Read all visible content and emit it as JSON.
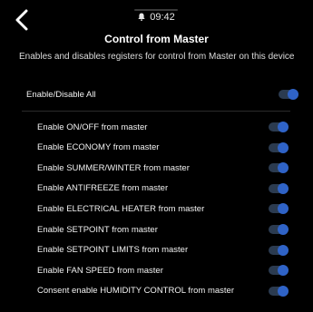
{
  "status_bar": {
    "time": "09:42",
    "icon": "bell-icon"
  },
  "header": {
    "back_icon": "chevron-left-icon",
    "title": "Control from Master"
  },
  "description": "Enables and disables registers for control from Master on this device",
  "master_toggle": {
    "label": "Enable/Disable All",
    "on": true
  },
  "items": [
    {
      "label": "Enable ON/OFF from master",
      "on": true
    },
    {
      "label": "Enable ECONOMY from master",
      "on": true
    },
    {
      "label": "Enable SUMMER/WINTER from master",
      "on": true
    },
    {
      "label": "Enable ANTIFREEZE from master",
      "on": true
    },
    {
      "label": "Enable ELECTRICAL HEATER from master",
      "on": true
    },
    {
      "label": "Enable SETPOINT from master",
      "on": true
    },
    {
      "label": "Enable SETPOINT LIMITS from master",
      "on": true
    },
    {
      "label": "Enable FAN SPEED from master",
      "on": true
    },
    {
      "label": "Consent enable HUMIDITY CONTROL from master",
      "on": true
    }
  ],
  "colors": {
    "background": "#000000",
    "toggle_knob": "#2f63c7",
    "toggle_track": "#2b3b50"
  }
}
